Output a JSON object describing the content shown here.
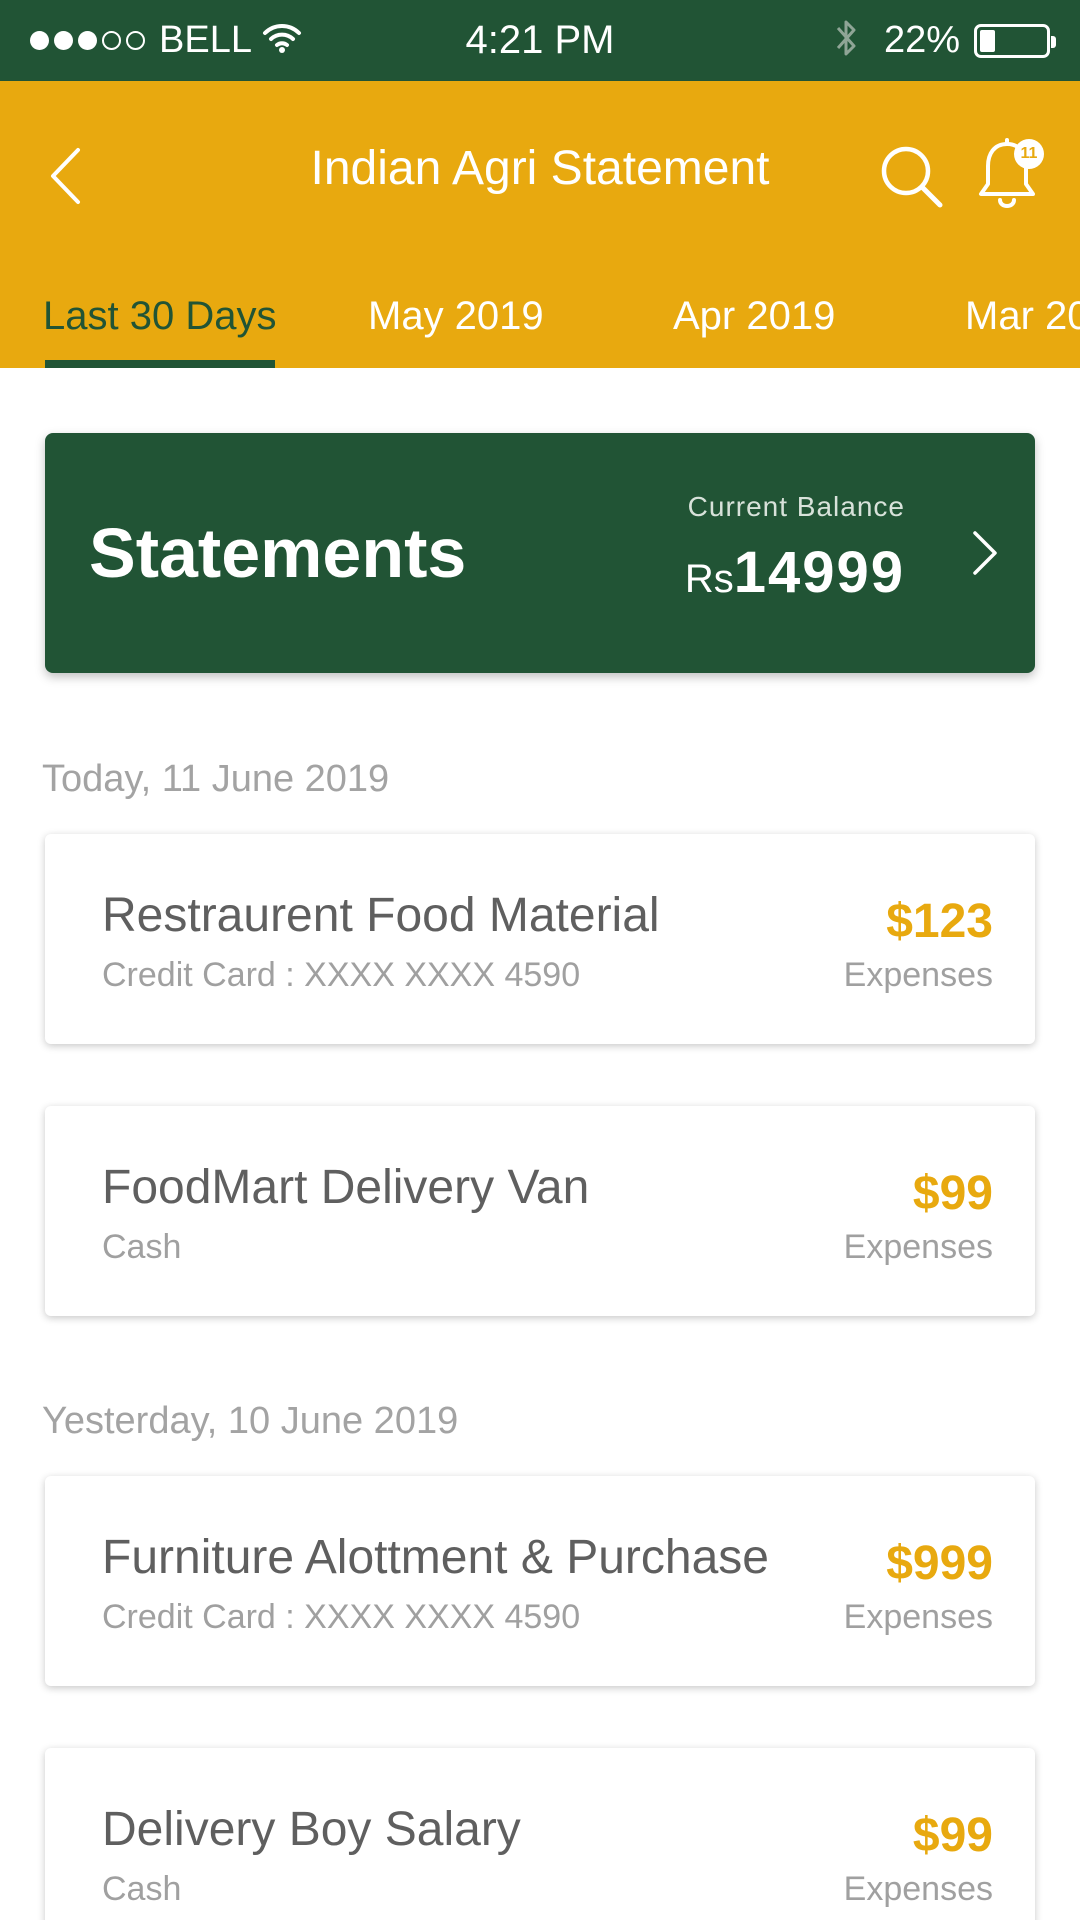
{
  "status_bar": {
    "carrier": "BELL",
    "time": "4:21 PM",
    "battery": "22%",
    "battery_level": 0.22,
    "signal_filled": 3,
    "signal_total": 5
  },
  "header": {
    "title": "Indian Agri Statement",
    "notification_count": "11"
  },
  "tabs": [
    {
      "label": "Last 30 Days",
      "active": true
    },
    {
      "label": "May 2019"
    },
    {
      "label": "Apr 2019"
    },
    {
      "label": "Mar 20"
    }
  ],
  "balance_card": {
    "title": "Statements",
    "label": "Current Balance",
    "currency": "Rs",
    "amount": "14999"
  },
  "sections": [
    {
      "date": "Today, 11 June 2019",
      "transactions": [
        {
          "title": "Restraurent Food Material",
          "subtitle": "Credit Card : XXXX XXXX 4590",
          "amount": "$123",
          "type": "Expenses"
        },
        {
          "title": "FoodMart Delivery Van",
          "subtitle": "Cash",
          "amount": "$99",
          "type": "Expenses"
        }
      ]
    },
    {
      "date": "Yesterday, 10 June 2019",
      "transactions": [
        {
          "title": "Furniture Alottment & Purchase",
          "subtitle": "Credit Card : XXXX XXXX 4590",
          "amount": "$999",
          "type": "Expenses"
        },
        {
          "title": "Delivery Boy Salary",
          "subtitle": "Cash",
          "amount": "$99",
          "type": "Expenses"
        }
      ]
    }
  ],
  "colors": {
    "primary_green": "#215435",
    "accent_yellow": "#E8A90F"
  },
  "icons": [
    "back-chevron-icon",
    "search-icon",
    "bell-icon",
    "chevron-right-icon",
    "wifi-icon",
    "bluetooth-icon",
    "battery-icon"
  ]
}
